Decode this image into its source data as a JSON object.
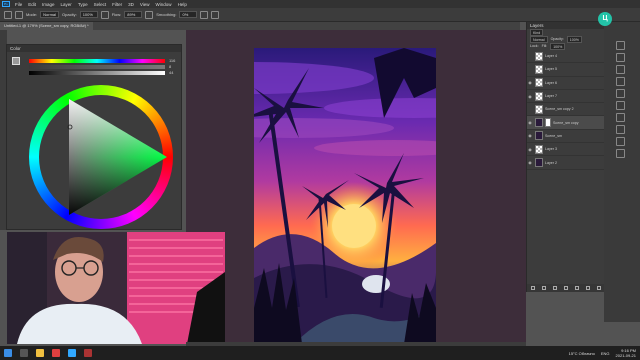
{
  "app": {
    "logo_text": "Ps"
  },
  "menu": [
    "File",
    "Edit",
    "Image",
    "Layer",
    "Type",
    "Select",
    "Filter",
    "3D",
    "View",
    "Window",
    "Help"
  ],
  "options": {
    "mode_label": "Mode:",
    "mode_value": "Normal",
    "opacity_label": "Opacity:",
    "opacity_value": "100%",
    "flow_label": "Flow:",
    "flow_value": "89%",
    "smoothing_label": "Smoothing:",
    "smoothing_value": "0%"
  },
  "document": {
    "tab_title": "Untitled-1 @ 179% (Scene_sm copy, RGB/8#) *"
  },
  "color_panel": {
    "title": "Color",
    "slider_values": [
      "116",
      "8",
      "44"
    ]
  },
  "layers_panel": {
    "title": "Layers",
    "kind_label": "Kind",
    "blend_mode": "Normal",
    "opacity_label": "Opacity:",
    "opacity_value": "100%",
    "lock_label": "Lock:",
    "fill_label": "Fill:",
    "fill_value": "100%",
    "layers": [
      {
        "name": "Layer 4",
        "visible": false,
        "thumb": "transparent"
      },
      {
        "name": "Layer 5",
        "visible": false,
        "thumb": "transparent"
      },
      {
        "name": "Layer 6",
        "visible": true,
        "thumb": "transparent"
      },
      {
        "name": "Layer 7",
        "visible": true,
        "thumb": "transparent"
      },
      {
        "name": "Scene_sm copy 2",
        "visible": false,
        "thumb": "transparent"
      },
      {
        "name": "Scene_sm copy",
        "visible": true,
        "thumb": "dark",
        "active": true
      },
      {
        "name": "Scene_sm",
        "visible": true,
        "thumb": "dark"
      },
      {
        "name": "Layer 3",
        "visible": true,
        "thumb": "transparent"
      },
      {
        "name": "Layer 2",
        "visible": true,
        "thumb": "dark"
      }
    ]
  },
  "badge": {
    "text": "Ц"
  },
  "taskbar": {
    "weather": "15°C Облачно",
    "lang": "ENG",
    "time": "9:16 PM",
    "date": "2021-09-21"
  },
  "colors": {
    "accent": "#31a8ff",
    "canvas_bg": "#3d2d3a",
    "badge": "#23c3a8"
  }
}
